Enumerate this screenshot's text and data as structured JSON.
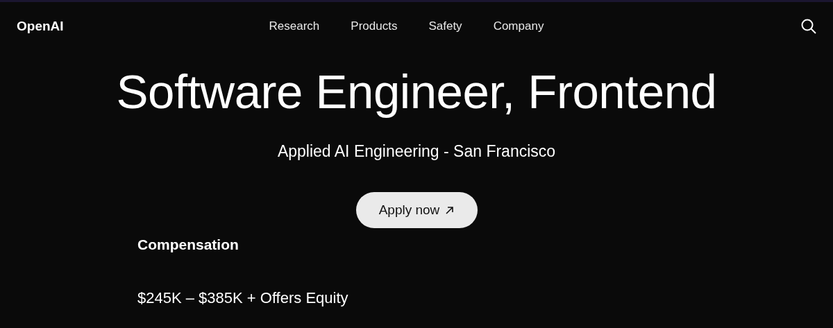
{
  "header": {
    "logo": "OpenAI",
    "nav": [
      {
        "label": "Research"
      },
      {
        "label": "Products"
      },
      {
        "label": "Safety"
      },
      {
        "label": "Company"
      }
    ]
  },
  "job": {
    "title": "Software Engineer, Frontend",
    "subtitle": "Applied AI Engineering - San Francisco",
    "apply_button": "Apply now"
  },
  "compensation": {
    "heading": "Compensation",
    "range": "$245K – $385K + Offers Equity"
  }
}
